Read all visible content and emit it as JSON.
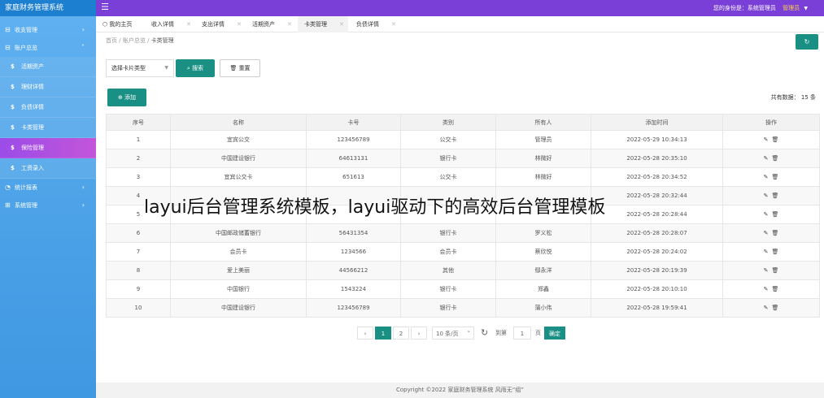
{
  "app": {
    "title": "家庭财务管理系统"
  },
  "header": {
    "identity_text": "您的身份是：系统管理员",
    "role": "管理员"
  },
  "sidebar": {
    "groups": [
      {
        "label": "收支管理",
        "icon": "wallet-icon"
      },
      {
        "label": "账户总览",
        "icon": "account-icon"
      }
    ],
    "items": [
      {
        "label": "活期资产"
      },
      {
        "label": "理财详情"
      },
      {
        "label": "负债详情"
      },
      {
        "label": "卡类管理"
      },
      {
        "label": "保险管理"
      },
      {
        "label": "工资录入"
      }
    ],
    "bottom_groups": [
      {
        "label": "统计报表"
      },
      {
        "label": "系统管理"
      }
    ]
  },
  "tabs": [
    {
      "label": "我的主页"
    },
    {
      "label": "收入详情"
    },
    {
      "label": "支出详情"
    },
    {
      "label": "活期资产"
    },
    {
      "label": "卡类管理"
    },
    {
      "label": "负债详情"
    }
  ],
  "breadcrumb": {
    "home": "首页",
    "parent": "账户总览",
    "current": "卡类管理"
  },
  "filters": {
    "select_value": "选择卡片类型",
    "search_label": "搜索",
    "reset_label": "重置"
  },
  "toolbar": {
    "add_label": "添加",
    "total_text": "共有数据： 15 条"
  },
  "table": {
    "columns": [
      "序号",
      "名称",
      "卡号",
      "类别",
      "所有人",
      "添加时间",
      "操作"
    ],
    "rows": [
      [
        "1",
        "宜宾公交",
        "123456789",
        "公交卡",
        "管理员",
        "2022-05-29 10:34:13"
      ],
      [
        "2",
        "中国建设银行",
        "64613131",
        "银行卡",
        "林微好",
        "2022-05-28 20:35:10"
      ],
      [
        "3",
        "宜宾公交卡",
        "651613",
        "公交卡",
        "林微好",
        "2022-05-28 20:34:52"
      ],
      [
        "4",
        "",
        "",
        "",
        "",
        "2022-05-28 20:32:44"
      ],
      [
        "5",
        "",
        "",
        "",
        "",
        "2022-05-28 20:28:44"
      ],
      [
        "6",
        "中国邮政储蓄银行",
        "56431354",
        "银行卡",
        "罗义松",
        "2022-05-28 20:28:07"
      ],
      [
        "7",
        "会员卡",
        "1234566",
        "会员卡",
        "蔡欣悦",
        "2022-05-28 20:24:02"
      ],
      [
        "8",
        "爱上美丽",
        "44566212",
        "其他",
        "鄢永洋",
        "2022-05-28 20:19:39"
      ],
      [
        "9",
        "中国银行",
        "1543224",
        "银行卡",
        "郑鑫",
        "2022-05-28 20:10:10"
      ],
      [
        "10",
        "中国建设银行",
        "123456789",
        "银行卡",
        "蒲小伟",
        "2022-05-28 19:59:41"
      ]
    ]
  },
  "pager": {
    "prev": "‹",
    "next": "›",
    "pages": [
      "1",
      "2"
    ],
    "current": "1",
    "page_size": "10 条/页",
    "goto_label": "到第",
    "goto_value": "1",
    "page_unit": "页",
    "confirm_label": "确定"
  },
  "footer": {
    "text": "Copyright ©2022 家庭财务管理系统 风雨无“组”"
  },
  "caption": {
    "text": "layui后台管理系统模板，layui驱动下的高效后台管理模板"
  },
  "colors": {
    "topbar": "#7a3fd6",
    "sidebar": "#4aa0e6",
    "accent": "#1a8f83",
    "active_nav": "#b152e0"
  }
}
